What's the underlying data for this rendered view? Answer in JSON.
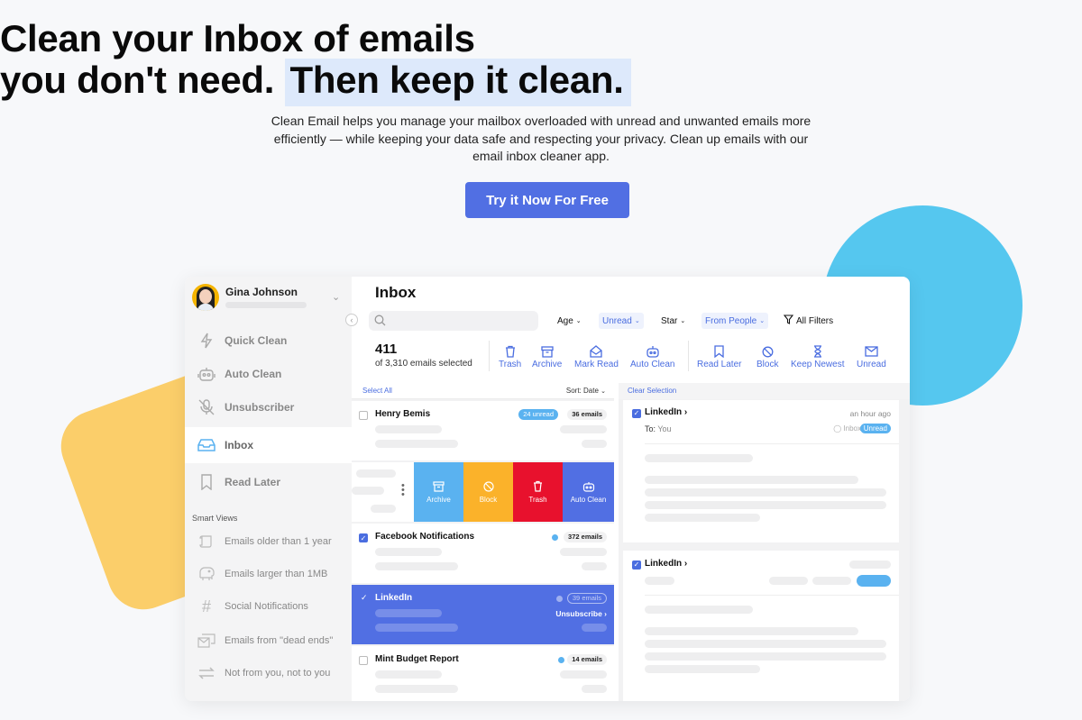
{
  "hero": {
    "headline_line1": "Clean your Inbox of emails",
    "headline_line2_plain": "you don't need.",
    "headline_line2_highlight": "Then keep it clean.",
    "subtext": "Clean Email helps you manage your mailbox overloaded with unread and unwanted emails more efficiently — while keeping your data safe and respecting your privacy. Clean up emails with our email inbox cleaner app.",
    "cta_label": "Try it Now For Free"
  },
  "colors": {
    "accent": "#516fe3",
    "highlight": "#dde9fb",
    "deco_yellow": "#fbce6a",
    "deco_blue": "#55c7ef",
    "unread_badge": "#5ab2f0",
    "block_orange": "#fbb22a",
    "trash_red": "#e8112d",
    "archive_blue": "#5ab2f0"
  },
  "sidebar": {
    "user_name": "Gina Johnson",
    "nav": [
      {
        "label": "Quick Clean",
        "icon": "lightning-icon"
      },
      {
        "label": "Auto Clean",
        "icon": "robot-icon"
      },
      {
        "label": "Unsubscriber",
        "icon": "muted-mic-icon"
      },
      {
        "label": "Inbox",
        "icon": "inbox-tray-icon",
        "active": true
      },
      {
        "label": "Read Later",
        "icon": "bookmark-icon"
      }
    ],
    "smart_views_title": "Smart Views",
    "smart_views": [
      {
        "label": "Emails older than 1 year",
        "icon": "scroll-icon"
      },
      {
        "label": "Emails larger than 1MB",
        "icon": "elephant-icon"
      },
      {
        "label": "Social Notifications",
        "icon": "hashtag-icon"
      },
      {
        "label": "Emails from \"dead ends\"",
        "icon": "dead-end-mail-icon"
      },
      {
        "label": "Not from you, not to you",
        "icon": "arrows-swap-icon"
      }
    ]
  },
  "main": {
    "title": "Inbox",
    "search_placeholder": "",
    "filters": [
      {
        "label": "Age",
        "active": false
      },
      {
        "label": "Unread",
        "active": true
      },
      {
        "label": "Star",
        "active": false
      },
      {
        "label": "From People",
        "active": true
      }
    ],
    "all_filters_label": "All Filters",
    "selected_count": "411",
    "selected_sub": "of 3,310 emails selected",
    "actions_group1": [
      "Trash",
      "Archive",
      "Mark Read",
      "Auto Clean"
    ],
    "actions_group2": [
      "Read Later",
      "Block",
      "Keep Newest",
      "Unread"
    ]
  },
  "list": {
    "select_all": "Select All",
    "sort": "Sort: Date",
    "rows": [
      {
        "name": "Henry Bemis",
        "unread": "24 unread",
        "count": "36 emails",
        "checked": false
      },
      {
        "name": "Facebook Notifications",
        "count": "372 emails",
        "checked": true
      },
      {
        "name": "LinkedIn",
        "count": "39 emails",
        "checked": true,
        "selected": true,
        "link": "Unsubscribe ›"
      },
      {
        "name": "Mint Budget Report",
        "count": "14 emails",
        "checked": false
      }
    ],
    "swipe_actions": [
      "Archive",
      "Block",
      "Trash",
      "Auto Clean"
    ]
  },
  "detail": {
    "clear_selection": "Clear Selection",
    "cards": [
      {
        "sender": "LinkedIn ›",
        "to_label": "To:",
        "to_value": "You",
        "time": "an hour ago",
        "tag": "Inbox",
        "badge": "Unread"
      },
      {
        "sender": "LinkedIn ›"
      }
    ]
  }
}
